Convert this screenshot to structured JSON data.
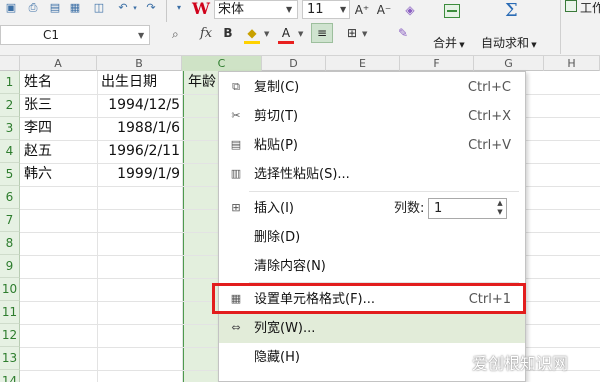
{
  "toolbar": {
    "font_name": "宋体",
    "font_size": "11",
    "grow_font_icon": "A⁺",
    "shrink_font_icon": "A⁻",
    "bold_icon": "B",
    "font_color_icon": "A",
    "merge_label": "合并",
    "autosum_label": "自动求和",
    "autosum_icon": "Σ",
    "workbook_label": "工作",
    "colors": {
      "fill_highlight": "#ffd200",
      "font_color": "#e8201f",
      "accent_green": "#4e9a4e"
    }
  },
  "formula_bar": {
    "name_box": "C1",
    "fx_label": "fx"
  },
  "grid": {
    "columns": [
      "A",
      "B",
      "C",
      "D",
      "E",
      "F",
      "G",
      "H"
    ],
    "rows": [
      "1",
      "2",
      "3",
      "4",
      "5",
      "6",
      "7",
      "8",
      "9",
      "10",
      "11",
      "12",
      "13",
      "14"
    ],
    "header_a": "姓名",
    "header_b": "出生日期",
    "header_c": "年龄",
    "data": [
      {
        "name": "张三",
        "birth": "1994/12/5"
      },
      {
        "name": "李四",
        "birth": "1988/1/6"
      },
      {
        "name": "赵五",
        "birth": "1996/2/11"
      },
      {
        "name": "韩六",
        "birth": "1999/1/9"
      }
    ]
  },
  "context_menu": {
    "copy": {
      "label": "复制(C)",
      "shortcut": "Ctrl+C"
    },
    "cut": {
      "label": "剪切(T)",
      "shortcut": "Ctrl+X"
    },
    "paste": {
      "label": "粘贴(P)",
      "shortcut": "Ctrl+V"
    },
    "paste_special": {
      "label": "选择性粘贴(S)..."
    },
    "insert": {
      "label": "插入(I)",
      "cols_label": "列数:",
      "cols_value": "1"
    },
    "delete": {
      "label": "删除(D)"
    },
    "clear": {
      "label": "清除内容(N)"
    },
    "format_cells": {
      "label": "设置单元格格式(F)...",
      "shortcut": "Ctrl+1"
    },
    "column_width": {
      "label": "列宽(W)..."
    },
    "hide": {
      "label": "隐藏(H)"
    }
  },
  "watermark": "爱创根知识网"
}
